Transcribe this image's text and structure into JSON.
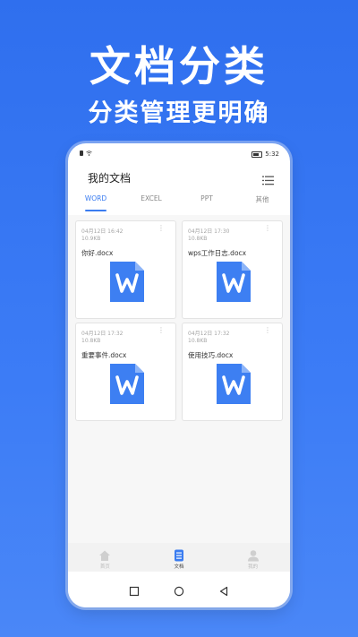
{
  "promo": {
    "headline": "文档分类",
    "subline": "分类管理更明确"
  },
  "statusbar": {
    "time": "5:32"
  },
  "header": {
    "title": "我的文档",
    "menu_icon": "list-menu-icon"
  },
  "tabs": [
    {
      "label": "WORD",
      "active": true
    },
    {
      "label": "EXCEL",
      "active": false
    },
    {
      "label": "PPT",
      "active": false
    },
    {
      "label": "其他",
      "active": false
    }
  ],
  "files": [
    {
      "date": "04月12日 16:42",
      "size": "10.9KB",
      "name": "你好.docx"
    },
    {
      "date": "04月12日 17:30",
      "size": "10.8KB",
      "name": "wps工作日志.docx"
    },
    {
      "date": "04月12日 17:32",
      "size": "10.8KB",
      "name": "重要事件.docx"
    },
    {
      "date": "04月12日 17:32",
      "size": "10.8KB",
      "name": "使用技巧.docx"
    }
  ],
  "bottom_nav": [
    {
      "label": "首页",
      "icon": "home-icon",
      "active": false
    },
    {
      "label": "文档",
      "icon": "document-icon",
      "active": true
    },
    {
      "label": "我的",
      "icon": "profile-icon",
      "active": false
    }
  ],
  "colors": {
    "background": "#2f6fee",
    "accent": "#3a7cf0",
    "word_icon": "#3d7ff2"
  }
}
